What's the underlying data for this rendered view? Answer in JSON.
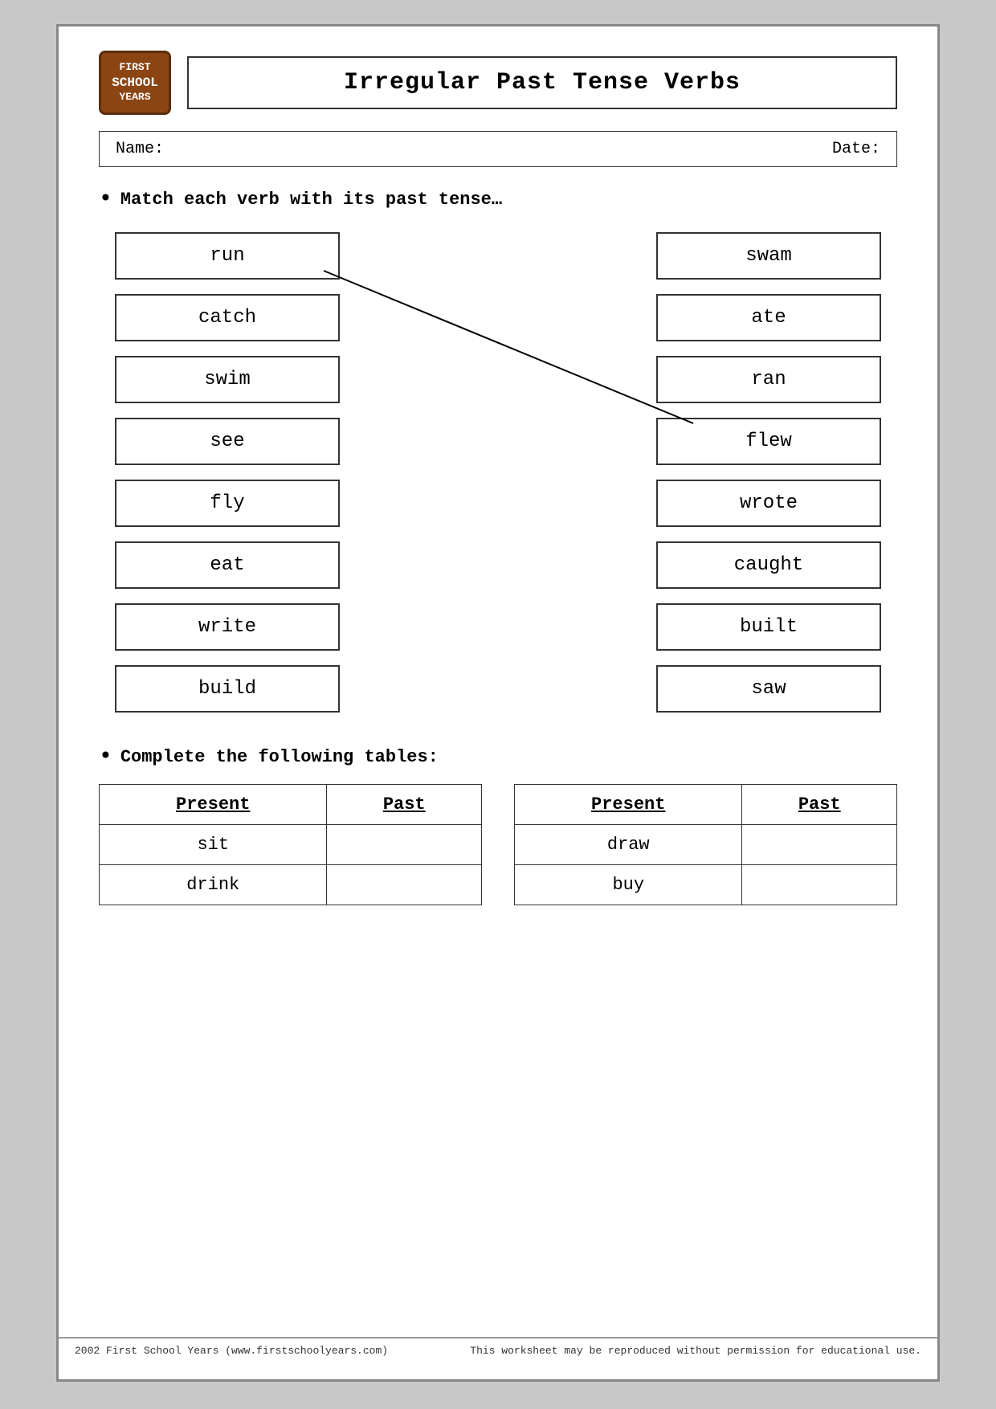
{
  "header": {
    "logo": {
      "line1": "FIRST",
      "line2": "SCHOOL",
      "line3": "YEARS"
    },
    "title": "Irregular Past Tense Verbs"
  },
  "nameRow": {
    "name_label": "Name:",
    "date_label": "Date:"
  },
  "instruction1": "Match each verb with its past tense…",
  "left_verbs": [
    "run",
    "catch",
    "swim",
    "see",
    "fly",
    "eat",
    "write",
    "build"
  ],
  "right_verbs": [
    "swam",
    "ate",
    "ran",
    "flew",
    "wrote",
    "caught",
    "built",
    "saw"
  ],
  "instruction2": "Complete the following tables:",
  "table1": {
    "headers": [
      "Present",
      "Past"
    ],
    "rows": [
      {
        "present": "sit",
        "past": ""
      },
      {
        "present": "drink",
        "past": ""
      }
    ]
  },
  "table2": {
    "headers": [
      "Present",
      "Past"
    ],
    "rows": [
      {
        "present": "draw",
        "past": ""
      },
      {
        "present": "buy",
        "past": ""
      }
    ]
  },
  "footer": {
    "left": "2002 First School Years  (www.firstschoolyears.com)",
    "right": "This worksheet may be reproduced without permission for educational use."
  }
}
